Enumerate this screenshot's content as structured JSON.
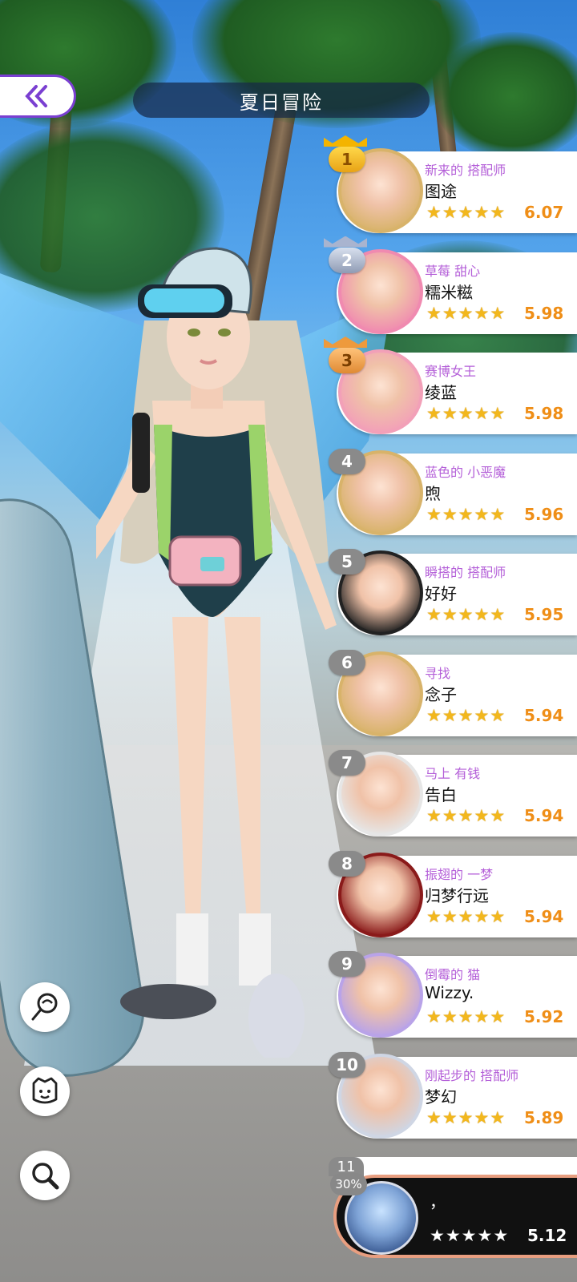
{
  "header": {
    "title": "夏日冒险",
    "back_icon": "double-chevron-left-icon"
  },
  "colors": {
    "accent_purple": "#7a3fd1",
    "subtitle": "#b45fd8",
    "score": "#ef8e17",
    "star": "#f2b71d"
  },
  "ranking": [
    {
      "rank": "1",
      "subtitle": "新来的 搭配师",
      "name": "图途",
      "score": "6.07",
      "stars": 5,
      "frame": "#d8b36a"
    },
    {
      "rank": "2",
      "subtitle": "草莓 甜心",
      "name": "糯米糍",
      "score": "5.98",
      "stars": 5,
      "frame": "#f08ab0"
    },
    {
      "rank": "3",
      "subtitle": "赛博女王",
      "name": "绫蓝",
      "score": "5.98",
      "stars": 5,
      "frame": "#f2a0b8"
    },
    {
      "rank": "4",
      "subtitle": "蓝色的 小恶魔",
      "name": "煦",
      "score": "5.96",
      "stars": 5,
      "frame": "#d8b36a"
    },
    {
      "rank": "5",
      "subtitle": "瞬搭的 搭配师",
      "name": "好好",
      "score": "5.95",
      "stars": 5,
      "frame": "#222222"
    },
    {
      "rank": "6",
      "subtitle": "寻找",
      "name": "念子",
      "score": "5.94",
      "stars": 5,
      "frame": "#d8b36a"
    },
    {
      "rank": "7",
      "subtitle": "马上 有钱",
      "name": "告白",
      "score": "5.94",
      "stars": 5,
      "frame": "#e6e6e6"
    },
    {
      "rank": "8",
      "subtitle": "振翅的 一梦",
      "name": "归梦行远",
      "score": "5.94",
      "stars": 5,
      "frame": "#8a1a1a"
    },
    {
      "rank": "9",
      "subtitle": "倒霉的 猫",
      "name": "Wizzy.",
      "score": "5.92",
      "stars": 5,
      "frame": "#b9a3e8"
    },
    {
      "rank": "10",
      "subtitle": "刚起步的 搭配师",
      "name": "梦幻",
      "score": "5.89",
      "stars": 5,
      "frame": "#cfd6e4"
    }
  ],
  "partial_rank": "11",
  "my_entry": {
    "percent": "30%",
    "name": "，",
    "score": "5.12",
    "stars": 5
  },
  "side_buttons": [
    {
      "name": "lollipop-icon"
    },
    {
      "name": "face-icon"
    },
    {
      "name": "magnifier-icon"
    }
  ]
}
